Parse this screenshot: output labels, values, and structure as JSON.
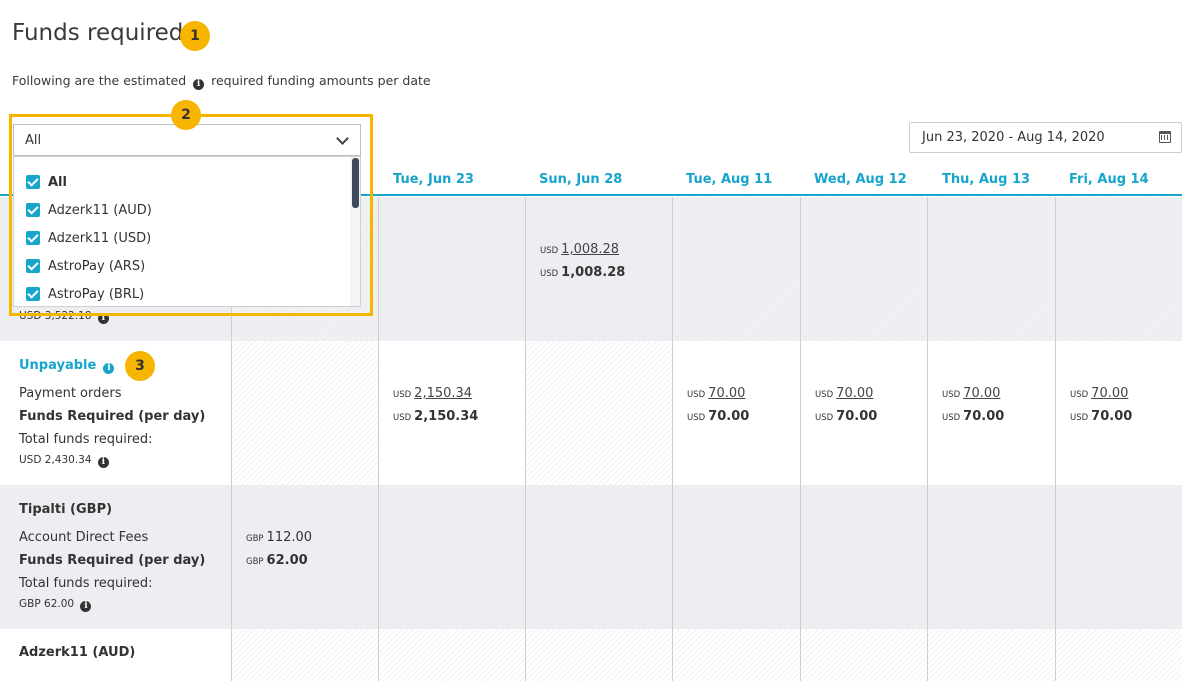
{
  "page": {
    "title": "Funds required",
    "subtitle_before": "Following are the estimated",
    "subtitle_after": "required funding amounts per date",
    "badges": [
      "1",
      "2",
      "3"
    ]
  },
  "filter": {
    "selected": "All",
    "options": [
      {
        "label": "All",
        "checked": true,
        "bold": true
      },
      {
        "label": "Adzerk11 (AUD)",
        "checked": true
      },
      {
        "label": "Adzerk11 (USD)",
        "checked": true
      },
      {
        "label": "AstroPay (ARS)",
        "checked": true
      },
      {
        "label": "AstroPay (BRL)",
        "checked": true
      }
    ]
  },
  "date_range": {
    "value": "Jun 23, 2020 - Aug 14, 2020",
    "icon": "calendar-icon"
  },
  "columns": [
    "Tue, Jun 23",
    "Sun, Jun 28",
    "Tue, Aug 11",
    "Wed, Aug 12",
    "Thu, Aug 13",
    "Fri, Aug 14"
  ],
  "rows": {
    "first": {
      "total_partial": "USD 3,522.18",
      "sun_jun28": {
        "currency": "USD",
        "payment": "1,008.28",
        "required": "1,008.28"
      }
    },
    "unpayable": {
      "name": "Unpayable",
      "line1": "Payment orders",
      "line2": "Funds Required (per day)",
      "line3": "Total funds required:",
      "total": "USD 2,430.34",
      "values": [
        {
          "col": "Tue, Jun 23",
          "currency": "USD",
          "payment": "2,150.34",
          "required": "2,150.34"
        },
        {
          "col": "Tue, Aug 11",
          "currency": "USD",
          "payment": "70.00",
          "required": "70.00"
        },
        {
          "col": "Wed, Aug 12",
          "currency": "USD",
          "payment": "70.00",
          "required": "70.00"
        },
        {
          "col": "Thu, Aug 13",
          "currency": "USD",
          "payment": "70.00",
          "required": "70.00"
        },
        {
          "col": "Fri, Aug 14",
          "currency": "USD",
          "payment": "70.00",
          "required": "70.00"
        }
      ]
    },
    "tipalti": {
      "name": "Tipalti (GBP)",
      "line1": "Account Direct Fees",
      "line2": "Funds Required (per day)",
      "line3": "Total funds required:",
      "total": "GBP 62.00",
      "first_col": {
        "currency": "GBP",
        "fees": "112.00",
        "required": "62.00"
      }
    },
    "adzerk": {
      "name": "Adzerk11 (AUD)"
    }
  },
  "colors": {
    "accent": "#17a5cc",
    "badge": "#f7b500",
    "band": "#eceef1"
  }
}
